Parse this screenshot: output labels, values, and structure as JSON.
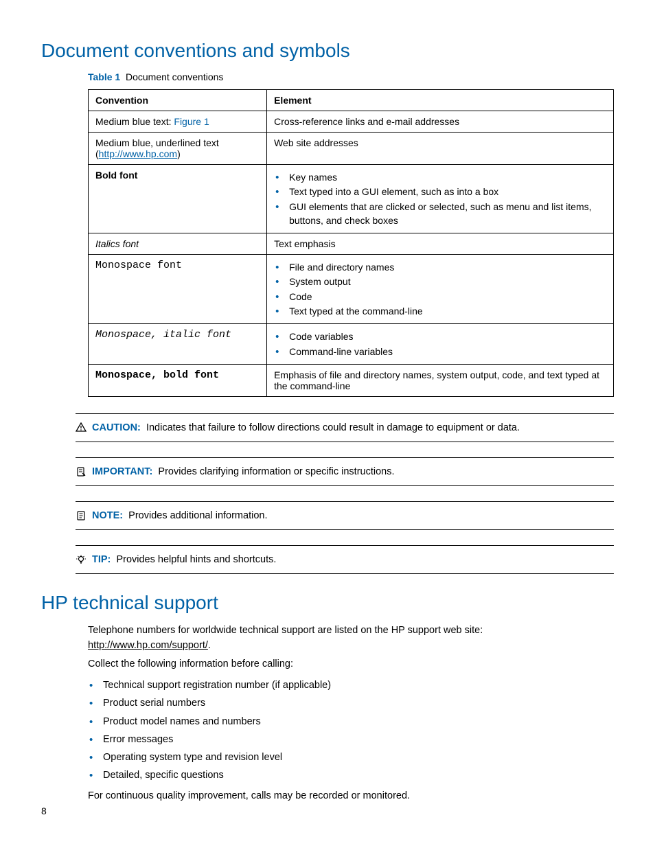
{
  "heading1": "Document conventions and symbols",
  "table": {
    "caption_lead": "Table 1",
    "caption_text": "Document conventions",
    "header_conv": "Convention",
    "header_elem": "Element",
    "rows": {
      "r0": {
        "conv_prefix": "Medium blue text: ",
        "conv_link": "Figure 1",
        "elem": "Cross-reference links and e-mail addresses"
      },
      "r1": {
        "conv_prefix": "Medium blue, underlined text",
        "conv_paren_open": "(",
        "conv_link": "http://www.hp.com",
        "conv_paren_close": ")",
        "elem": "Web site addresses"
      },
      "r2": {
        "conv": "Bold font",
        "b0": "Key names",
        "b1": "Text typed into a GUI element, such as into a box",
        "b2": "GUI elements that are clicked or selected, such as menu and list items, buttons, and check boxes"
      },
      "r3": {
        "conv": "Italics font",
        "elem": "Text emphasis"
      },
      "r4": {
        "conv": "Monospace font",
        "b0": "File and directory names",
        "b1": "System output",
        "b2": "Code",
        "b3": "Text typed at the command-line"
      },
      "r5": {
        "conv": "Monospace, italic font",
        "b0": "Code variables",
        "b1": "Command-line variables"
      },
      "r6": {
        "conv": "Monospace, bold font",
        "elem": "Emphasis of file and directory names, system output, code, and text typed at the command-line"
      }
    }
  },
  "admon": {
    "caution_lead": "CAUTION:",
    "caution_text": "Indicates that failure to follow directions could result in damage to equipment or data.",
    "important_lead": "IMPORTANT:",
    "important_text": "Provides clarifying information or specific instructions.",
    "note_lead": "NOTE:",
    "note_text": "Provides additional information.",
    "tip_lead": "TIP:",
    "tip_text": "Provides helpful hints and shortcuts."
  },
  "heading2": "HP technical support",
  "support": {
    "p1a": "Telephone numbers for worldwide technical support are listed on the HP support web site: ",
    "link": "http://www.hp.com/support/",
    "p1b": ".",
    "p2": "Collect the following information before calling:",
    "li0": "Technical support registration number (if applicable)",
    "li1": "Product serial numbers",
    "li2": "Product model names and numbers",
    "li3": "Error messages",
    "li4": "Operating system type and revision level",
    "li5": "Detailed, specific questions",
    "p3": "For continuous quality improvement, calls may be recorded or monitored."
  },
  "pagenum": "8"
}
